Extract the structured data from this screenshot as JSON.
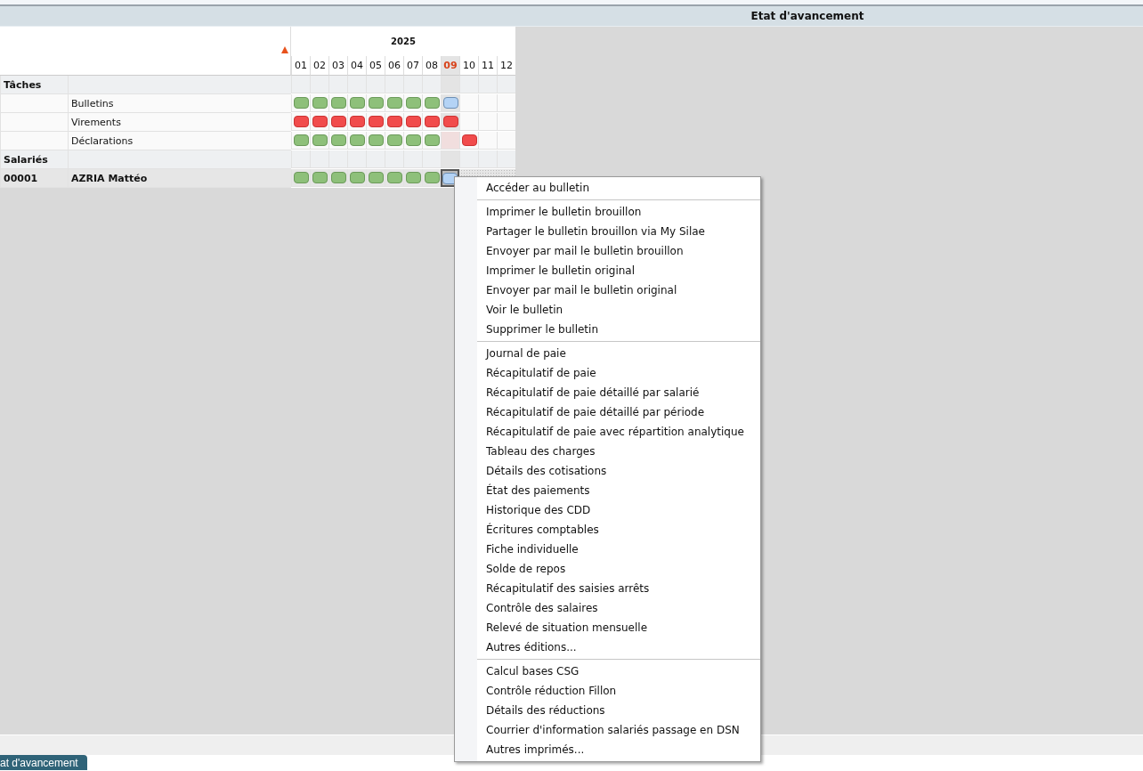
{
  "title": "Etat d'avancement",
  "year": "2025",
  "months": [
    {
      "label": "01",
      "current": false
    },
    {
      "label": "02",
      "current": false
    },
    {
      "label": "03",
      "current": false
    },
    {
      "label": "04",
      "current": false
    },
    {
      "label": "05",
      "current": false
    },
    {
      "label": "06",
      "current": false
    },
    {
      "label": "07",
      "current": false
    },
    {
      "label": "08",
      "current": false
    },
    {
      "label": "09",
      "current": true
    },
    {
      "label": "10",
      "current": false
    },
    {
      "label": "11",
      "current": false
    },
    {
      "label": "12",
      "current": false
    }
  ],
  "rows": [
    {
      "kind": "group",
      "code": "Tâches",
      "selected": false
    },
    {
      "kind": "task",
      "label": "Bulletins",
      "selected": false,
      "cells": [
        {
          "kind": "done"
        },
        {
          "kind": "done"
        },
        {
          "kind": "done"
        },
        {
          "kind": "done"
        },
        {
          "kind": "done"
        },
        {
          "kind": "done"
        },
        {
          "kind": "done"
        },
        {
          "kind": "done"
        },
        {
          "kind": "pending"
        }
      ]
    },
    {
      "kind": "task",
      "label": "Virements",
      "selected": false,
      "cells": [
        {
          "kind": "error"
        },
        {
          "kind": "error"
        },
        {
          "kind": "error"
        },
        {
          "kind": "error"
        },
        {
          "kind": "error"
        },
        {
          "kind": "error"
        },
        {
          "kind": "error"
        },
        {
          "kind": "error"
        },
        {
          "kind": "error"
        }
      ]
    },
    {
      "kind": "task",
      "label": "Déclarations",
      "selected": false,
      "cells": [
        {
          "kind": "done"
        },
        {
          "kind": "done"
        },
        {
          "kind": "done"
        },
        {
          "kind": "done"
        },
        {
          "kind": "done"
        },
        {
          "kind": "done"
        },
        {
          "kind": "done"
        },
        {
          "kind": "done"
        },
        {
          "kind": "late"
        },
        {
          "kind": "error"
        }
      ]
    },
    {
      "kind": "group",
      "code": "Salariés",
      "selected": false
    },
    {
      "kind": "employee",
      "code": "00001",
      "label": "AZRIA Mattéo",
      "selected": true,
      "cells": [
        {
          "kind": "done"
        },
        {
          "kind": "done"
        },
        {
          "kind": "done"
        },
        {
          "kind": "done"
        },
        {
          "kind": "done"
        },
        {
          "kind": "done"
        },
        {
          "kind": "done"
        },
        {
          "kind": "done"
        },
        {
          "kind": "focused"
        },
        {
          "kind": "future"
        },
        {
          "kind": "future"
        },
        {
          "kind": "future"
        }
      ]
    }
  ],
  "context_menu": [
    [
      "Accéder au bulletin"
    ],
    [
      "Imprimer le bulletin brouillon",
      "Partager le bulletin brouillon via My Silae",
      "Envoyer par mail le bulletin brouillon",
      "Imprimer le bulletin original",
      "Envoyer par mail le bulletin original",
      "Voir le bulletin",
      "Supprimer le bulletin"
    ],
    [
      "Journal de paie",
      "Récapitulatif de paie",
      "Récapitulatif de paie détaillé par salarié",
      "Récapitulatif de paie détaillé par période",
      "Récapitulatif de paie avec répartition analytique",
      "Tableau des charges",
      "Détails des cotisations",
      "État des paiements",
      "Historique des CDD",
      "Écritures comptables",
      "Fiche individuelle",
      "Solde de repos",
      "Récapitulatif des saisies arrêts",
      "Contrôle des salaires",
      "Relevé de situation mensuelle",
      "Autres éditions..."
    ],
    [
      "Calcul bases CSG",
      "Contrôle réduction Fillon",
      "Détails des réductions",
      "Courrier d'information salariés passage en DSN",
      "Autres imprimés..."
    ]
  ],
  "bottom_tabs": [
    {
      "label": "at d'avancement",
      "selected": true
    }
  ]
}
